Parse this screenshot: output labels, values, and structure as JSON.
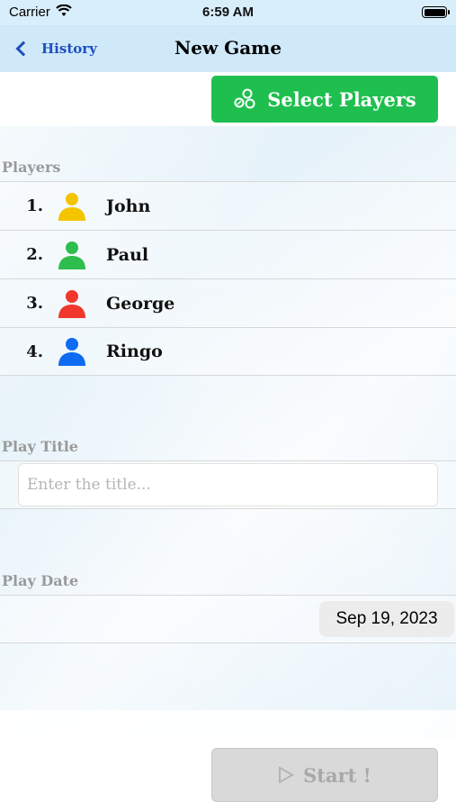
{
  "status_bar": {
    "carrier": "Carrier",
    "time": "6:59 AM"
  },
  "nav": {
    "back_label": "History",
    "title": "New Game"
  },
  "select_players": {
    "label": "Select Players"
  },
  "players_section": {
    "header": "Players",
    "players": [
      {
        "number": "1.",
        "name": "John",
        "color": "#f5c400"
      },
      {
        "number": "2.",
        "name": "Paul",
        "color": "#2dbe4e"
      },
      {
        "number": "3.",
        "name": "George",
        "color": "#f1362d"
      },
      {
        "number": "4.",
        "name": "Ringo",
        "color": "#0f6bf2"
      }
    ]
  },
  "play_title": {
    "header": "Play Title",
    "placeholder": "Enter the title...",
    "value": ""
  },
  "play_date": {
    "header": "Play Date",
    "value": "Sep 19, 2023"
  },
  "start_button": {
    "label": "Start !"
  },
  "colors": {
    "accent_green": "#1fbf4f",
    "nav_blue": "#1f4fbf",
    "nav_bg": "#cfe9f9"
  }
}
